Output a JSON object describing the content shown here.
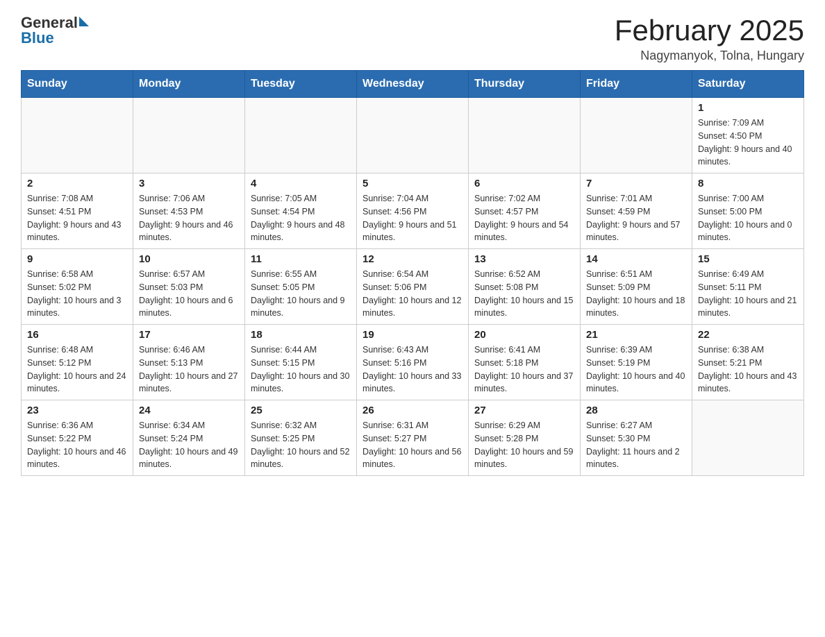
{
  "header": {
    "logo_general": "General",
    "logo_blue": "Blue",
    "title": "February 2025",
    "subtitle": "Nagymanyok, Tolna, Hungary"
  },
  "weekdays": [
    "Sunday",
    "Monday",
    "Tuesday",
    "Wednesday",
    "Thursday",
    "Friday",
    "Saturday"
  ],
  "weeks": [
    [
      {
        "day": "",
        "info": ""
      },
      {
        "day": "",
        "info": ""
      },
      {
        "day": "",
        "info": ""
      },
      {
        "day": "",
        "info": ""
      },
      {
        "day": "",
        "info": ""
      },
      {
        "day": "",
        "info": ""
      },
      {
        "day": "1",
        "info": "Sunrise: 7:09 AM\nSunset: 4:50 PM\nDaylight: 9 hours and 40 minutes."
      }
    ],
    [
      {
        "day": "2",
        "info": "Sunrise: 7:08 AM\nSunset: 4:51 PM\nDaylight: 9 hours and 43 minutes."
      },
      {
        "day": "3",
        "info": "Sunrise: 7:06 AM\nSunset: 4:53 PM\nDaylight: 9 hours and 46 minutes."
      },
      {
        "day": "4",
        "info": "Sunrise: 7:05 AM\nSunset: 4:54 PM\nDaylight: 9 hours and 48 minutes."
      },
      {
        "day": "5",
        "info": "Sunrise: 7:04 AM\nSunset: 4:56 PM\nDaylight: 9 hours and 51 minutes."
      },
      {
        "day": "6",
        "info": "Sunrise: 7:02 AM\nSunset: 4:57 PM\nDaylight: 9 hours and 54 minutes."
      },
      {
        "day": "7",
        "info": "Sunrise: 7:01 AM\nSunset: 4:59 PM\nDaylight: 9 hours and 57 minutes."
      },
      {
        "day": "8",
        "info": "Sunrise: 7:00 AM\nSunset: 5:00 PM\nDaylight: 10 hours and 0 minutes."
      }
    ],
    [
      {
        "day": "9",
        "info": "Sunrise: 6:58 AM\nSunset: 5:02 PM\nDaylight: 10 hours and 3 minutes."
      },
      {
        "day": "10",
        "info": "Sunrise: 6:57 AM\nSunset: 5:03 PM\nDaylight: 10 hours and 6 minutes."
      },
      {
        "day": "11",
        "info": "Sunrise: 6:55 AM\nSunset: 5:05 PM\nDaylight: 10 hours and 9 minutes."
      },
      {
        "day": "12",
        "info": "Sunrise: 6:54 AM\nSunset: 5:06 PM\nDaylight: 10 hours and 12 minutes."
      },
      {
        "day": "13",
        "info": "Sunrise: 6:52 AM\nSunset: 5:08 PM\nDaylight: 10 hours and 15 minutes."
      },
      {
        "day": "14",
        "info": "Sunrise: 6:51 AM\nSunset: 5:09 PM\nDaylight: 10 hours and 18 minutes."
      },
      {
        "day": "15",
        "info": "Sunrise: 6:49 AM\nSunset: 5:11 PM\nDaylight: 10 hours and 21 minutes."
      }
    ],
    [
      {
        "day": "16",
        "info": "Sunrise: 6:48 AM\nSunset: 5:12 PM\nDaylight: 10 hours and 24 minutes."
      },
      {
        "day": "17",
        "info": "Sunrise: 6:46 AM\nSunset: 5:13 PM\nDaylight: 10 hours and 27 minutes."
      },
      {
        "day": "18",
        "info": "Sunrise: 6:44 AM\nSunset: 5:15 PM\nDaylight: 10 hours and 30 minutes."
      },
      {
        "day": "19",
        "info": "Sunrise: 6:43 AM\nSunset: 5:16 PM\nDaylight: 10 hours and 33 minutes."
      },
      {
        "day": "20",
        "info": "Sunrise: 6:41 AM\nSunset: 5:18 PM\nDaylight: 10 hours and 37 minutes."
      },
      {
        "day": "21",
        "info": "Sunrise: 6:39 AM\nSunset: 5:19 PM\nDaylight: 10 hours and 40 minutes."
      },
      {
        "day": "22",
        "info": "Sunrise: 6:38 AM\nSunset: 5:21 PM\nDaylight: 10 hours and 43 minutes."
      }
    ],
    [
      {
        "day": "23",
        "info": "Sunrise: 6:36 AM\nSunset: 5:22 PM\nDaylight: 10 hours and 46 minutes."
      },
      {
        "day": "24",
        "info": "Sunrise: 6:34 AM\nSunset: 5:24 PM\nDaylight: 10 hours and 49 minutes."
      },
      {
        "day": "25",
        "info": "Sunrise: 6:32 AM\nSunset: 5:25 PM\nDaylight: 10 hours and 52 minutes."
      },
      {
        "day": "26",
        "info": "Sunrise: 6:31 AM\nSunset: 5:27 PM\nDaylight: 10 hours and 56 minutes."
      },
      {
        "day": "27",
        "info": "Sunrise: 6:29 AM\nSunset: 5:28 PM\nDaylight: 10 hours and 59 minutes."
      },
      {
        "day": "28",
        "info": "Sunrise: 6:27 AM\nSunset: 5:30 PM\nDaylight: 11 hours and 2 minutes."
      },
      {
        "day": "",
        "info": ""
      }
    ]
  ]
}
